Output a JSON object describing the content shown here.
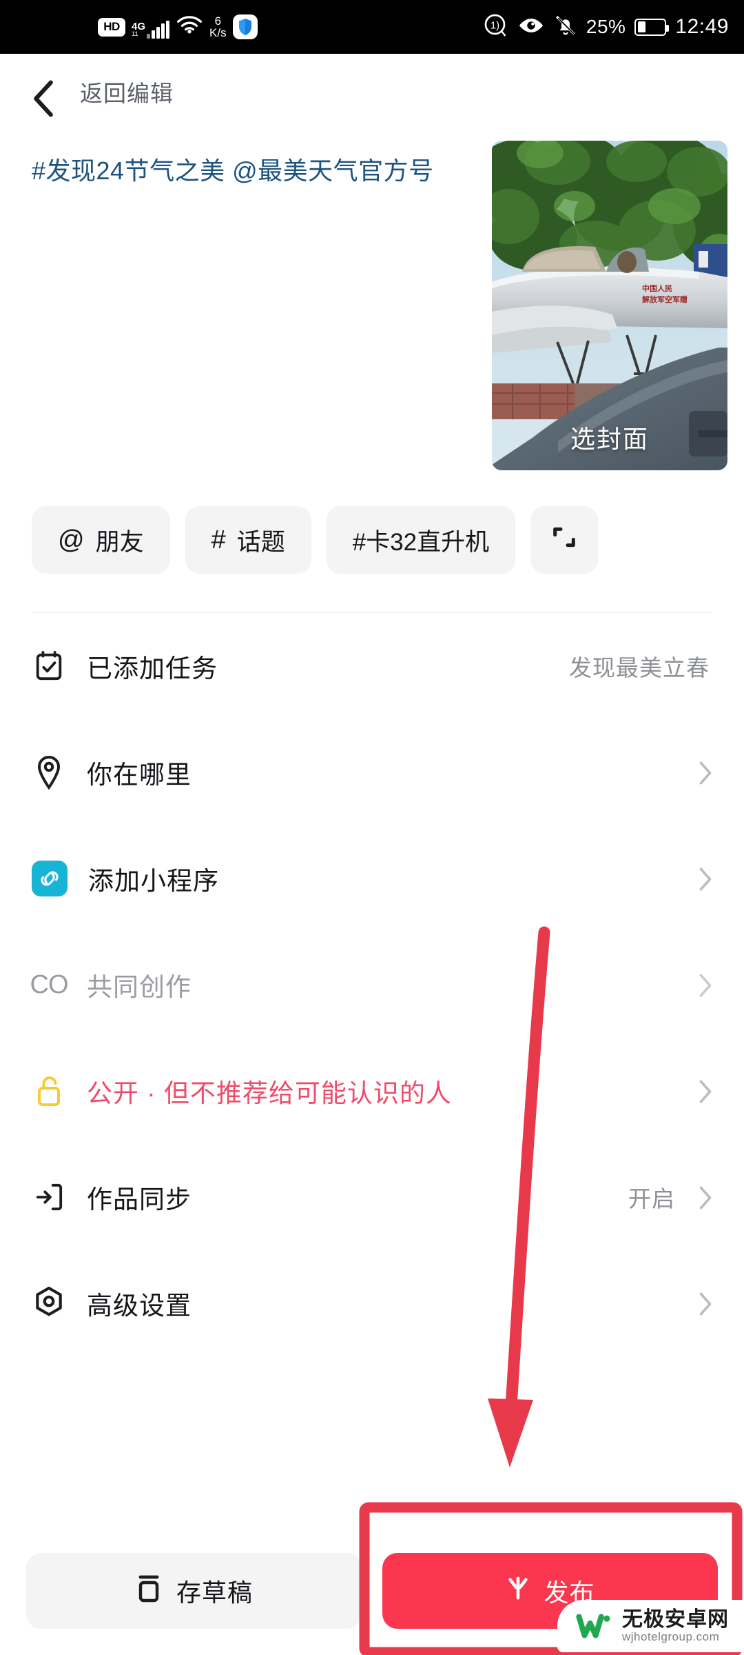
{
  "statusbar": {
    "hd_label": "HD",
    "network_label": "4G",
    "network_sub": "11",
    "speed_value": "6",
    "speed_unit": "K/s",
    "battery_percent": "25%",
    "clock": "12:49",
    "icons": [
      "hd-badge",
      "signal-bars",
      "wifi-icon",
      "data-speed",
      "shield-icon",
      "volume-limit-icon",
      "eye-care-icon",
      "mute-bell-icon",
      "battery-icon"
    ]
  },
  "header": {
    "back_icon": "back-chevron-icon",
    "title": "返回编辑"
  },
  "editor": {
    "caption": "#发现24节气之美 @最美天气官方号",
    "cover_label": "选封面"
  },
  "chips": [
    {
      "symbol": "@",
      "label": "朋友",
      "name": "chip-mention-friend"
    },
    {
      "symbol": "#",
      "label": "话题",
      "name": "chip-topic"
    },
    {
      "symbol": "",
      "label": "#卡32直升机",
      "name": "chip-hashtag-ka32"
    },
    {
      "symbol": "",
      "label": "",
      "name": "chip-scan-expand",
      "icon_only": true
    }
  ],
  "rows": [
    {
      "icon": "calendar-check-icon",
      "label": "已添加任务",
      "value": "发现最美立春",
      "chevron": false,
      "style": "normal"
    },
    {
      "icon": "location-pin-icon",
      "label": "你在哪里",
      "value": "",
      "chevron": true,
      "style": "normal"
    },
    {
      "icon": "mini-program-icon",
      "label": "添加小程序",
      "value": "",
      "chevron": true,
      "style": "normal"
    },
    {
      "icon": "co-create-icon",
      "label": "共同创作",
      "value": "",
      "chevron": true,
      "style": "muted"
    },
    {
      "icon": "unlock-icon",
      "label": "公开 · 但不推荐给可能认识的人",
      "value": "",
      "chevron": true,
      "style": "danger"
    },
    {
      "icon": "sync-icon",
      "label": "作品同步",
      "value": "开启",
      "chevron": true,
      "style": "normal"
    },
    {
      "icon": "hexagon-settings-icon",
      "label": "高级设置",
      "value": "",
      "chevron": true,
      "style": "normal"
    }
  ],
  "bottombar": {
    "draft_icon": "draft-box-icon",
    "draft_label": "存草稿",
    "publish_icon": "sparkle-icon",
    "publish_label": "发布"
  },
  "annotation": {
    "arrow_color": "#e8394a",
    "box_color": "#e8394a",
    "arrow_name": "red-arrow-pointing-to-publish",
    "box_name": "red-highlight-box-publish"
  },
  "watermark": {
    "name": "无极安卓网",
    "url": "wjhotelgroup.com",
    "logo_color": "#1fa84f"
  },
  "colors": {
    "accent_publish": "#fb364f",
    "caption_blue": "#1d5380",
    "danger_pink": "#f24a6a",
    "unlock_yellow": "#f5cc35",
    "mini_program_cyan": "#17b4d6",
    "chip_bg": "#f4f4f5"
  }
}
